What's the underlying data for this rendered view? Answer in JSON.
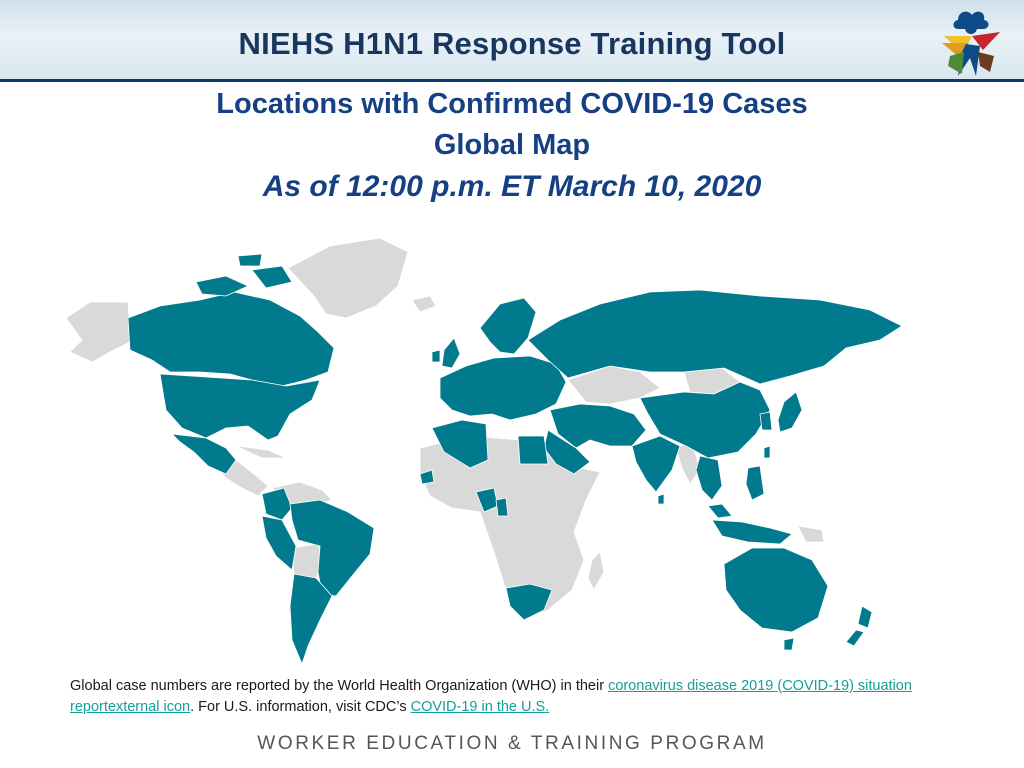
{
  "header": {
    "title": "NIEHS H1N1 Response Training Tool",
    "logo_icon": "worker-training-logo-icon"
  },
  "slide": {
    "title_line1": "Locations with Confirmed COVID-19 Cases",
    "title_line2": "Global Map",
    "title_line3": "As of 12:00 p.m. ET March 10, 2020"
  },
  "map": {
    "affected_color": "#007a8c",
    "unaffected_color": "#d9d9d9"
  },
  "caption": {
    "text1": "Global case numbers are reported by the World Health Organization (WHO) in their ",
    "link1": "coronavirus disease 2019 (COVID-19) situation reportexternal icon",
    "text2": ". For U.S. information, visit CDC’s ",
    "link2": "COVID-19 in the U.S."
  },
  "footer": {
    "text": "WORKER EDUCATION & TRAINING PROGRAM"
  },
  "colors": {
    "header_text": "#18365e",
    "title_text": "#163f84",
    "link": "#14a09a"
  }
}
